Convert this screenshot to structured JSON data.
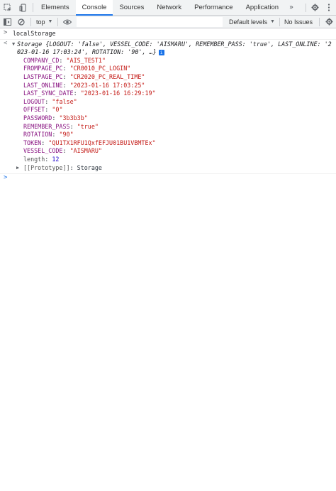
{
  "tabs": {
    "items": [
      {
        "label": "Elements",
        "active": false
      },
      {
        "label": "Console",
        "active": true
      },
      {
        "label": "Sources",
        "active": false
      },
      {
        "label": "Network",
        "active": false
      },
      {
        "label": "Performance",
        "active": false
      },
      {
        "label": "Application",
        "active": false
      }
    ],
    "more": "»"
  },
  "toolbar": {
    "context": "top",
    "filter_placeholder": "Filter",
    "levels": "Default levels",
    "issues": "No Issues"
  },
  "console": {
    "input_prompt": ">",
    "input": "localStorage",
    "result_marker": "<",
    "summary": "Storage {LOGOUT: 'false', VESSEL_CODE: 'AISMARU', REMEMBER_PASS: 'true', LAST_ONLINE: '2023-01-16 17:03:24', ROTATION: '90', …}",
    "info_badge": "i",
    "properties": [
      {
        "key": "COMPANY_CD",
        "value": "\"AIS_TEST1\""
      },
      {
        "key": "FROMPAGE_PC",
        "value": "\"CR0010_PC_LOGIN\""
      },
      {
        "key": "LASTPAGE_PC",
        "value": "\"CR2020_PC_REAL_TIME\""
      },
      {
        "key": "LAST_ONLINE",
        "value": "\"2023-01-16 17:03:25\""
      },
      {
        "key": "LAST_SYNC_DATE",
        "value": "\"2023-01-16 16:29:19\""
      },
      {
        "key": "LOGOUT",
        "value": "\"false\""
      },
      {
        "key": "OFFSET",
        "value": "\"0\""
      },
      {
        "key": "PASSWORD",
        "value": "\"3b3b3b\""
      },
      {
        "key": "REMEMBER_PASS",
        "value": "\"true\""
      },
      {
        "key": "ROTATION",
        "value": "\"90\""
      },
      {
        "key": "TOKEN",
        "value": "\"QU1TX1RFU1QxfEFJU01BU1VBMTEx\""
      },
      {
        "key": "VESSEL_CODE",
        "value": "\"AISMARU\""
      }
    ],
    "length_key": "length",
    "length_value": "12",
    "prototype_key": "[[Prototype]]",
    "prototype_value": "Storage",
    "caret_prompt": ">"
  },
  "colors": {
    "accent": "#1a73e8",
    "string": "#c41a16",
    "key": "#881280",
    "number": "#1c00cf"
  },
  "icons": [
    "inspect-icon",
    "device-toggle-icon",
    "more-tabs-icon",
    "settings-icon",
    "kebab-menu-icon",
    "sidebar-toggle-icon",
    "clear-console-icon",
    "eye-icon",
    "info-icon"
  ]
}
